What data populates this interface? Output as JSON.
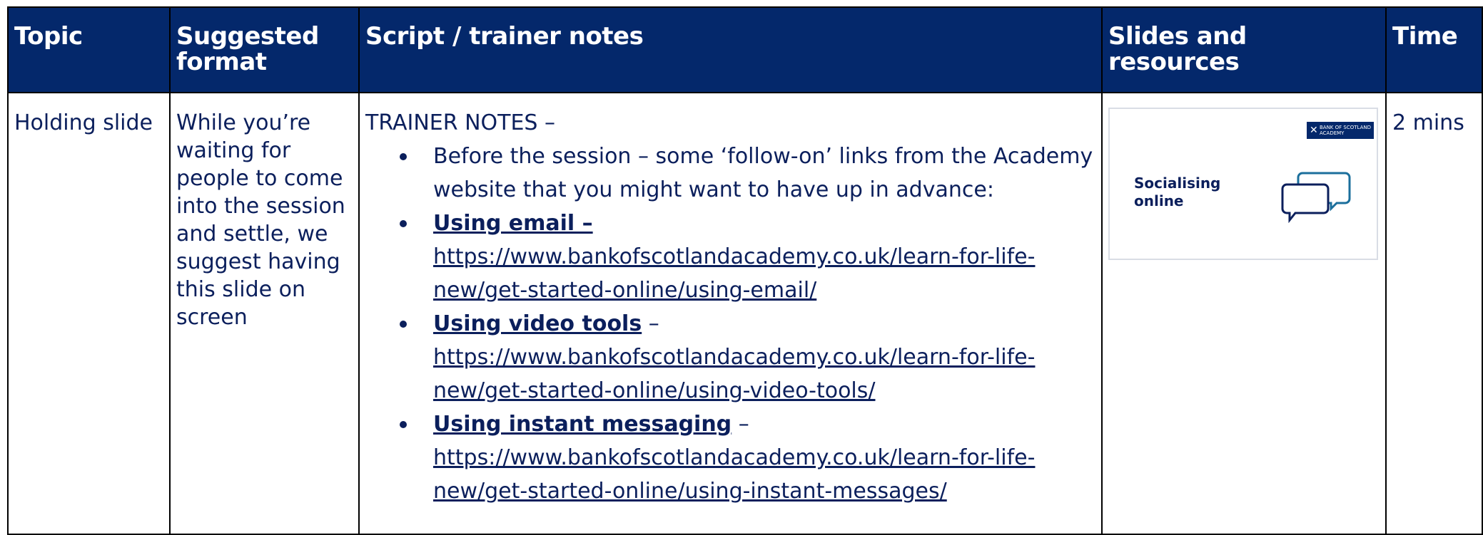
{
  "headers": {
    "topic": "Topic",
    "format": "Suggested format",
    "script": "Script / trainer notes",
    "slides": "Slides and resources",
    "time": "Time"
  },
  "row": {
    "topic": "Holding slide",
    "format": "While you’re waiting for people to come into the session and settle, we suggest having this slide on screen",
    "notes_title": "TRAINER NOTES –",
    "bullets": [
      {
        "text": "Before the session – some ‘follow-on’ links from the Academy website that you might want to have up in advance:"
      },
      {
        "lead": "Using email –",
        "dash": "",
        "url": "https://www.bankofscotlandacademy.co.uk/learn-for-life-new/get-started-online/using-email/"
      },
      {
        "lead": "Using video tools",
        "dash": " –",
        "url": "https://www.bankofscotlandacademy.co.uk/learn-for-life-new/get-started-online/using-video-tools/"
      },
      {
        "lead": "Using instant messaging",
        "dash": " –",
        "url": "https://www.bankofscotlandacademy.co.uk/learn-for-life-new/get-started-online/using-instant-messages/"
      }
    ],
    "slide_thumbnail": {
      "title": "Socialising online",
      "logo_text": "BANK OF SCOTLAND ACADEMY",
      "icon": "chat-bubbles-icon"
    },
    "time": "2 mins"
  },
  "colors": {
    "header_bg": "#04286b",
    "header_text": "#ffffff",
    "body_text": "#0b1f5c"
  }
}
